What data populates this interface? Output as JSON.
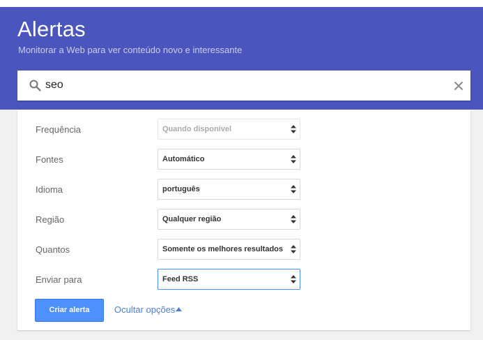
{
  "header": {
    "title": "Alertas",
    "subtitle": "Monitorar a Web para ver conteúdo novo e interessante"
  },
  "search": {
    "value": "seo",
    "search_icon": "search-icon",
    "clear_icon": "close-icon"
  },
  "options": [
    {
      "label": "Frequência",
      "value": "Quando disponível",
      "disabled": true
    },
    {
      "label": "Fontes",
      "value": "Automático"
    },
    {
      "label": "Idioma",
      "value": "português"
    },
    {
      "label": "Região",
      "value": "Qualquer região"
    },
    {
      "label": "Quantos",
      "value": "Somente os melhores resultados"
    },
    {
      "label": "Enviar para",
      "value": "Feed RSS",
      "focused": true
    }
  ],
  "actions": {
    "create_label": "Criar alerta",
    "hide_options_label": "Ocultar opções"
  },
  "colors": {
    "header_bg": "#4a56bd",
    "button_bg": "#4d90fe",
    "link": "#4d7fd6"
  }
}
